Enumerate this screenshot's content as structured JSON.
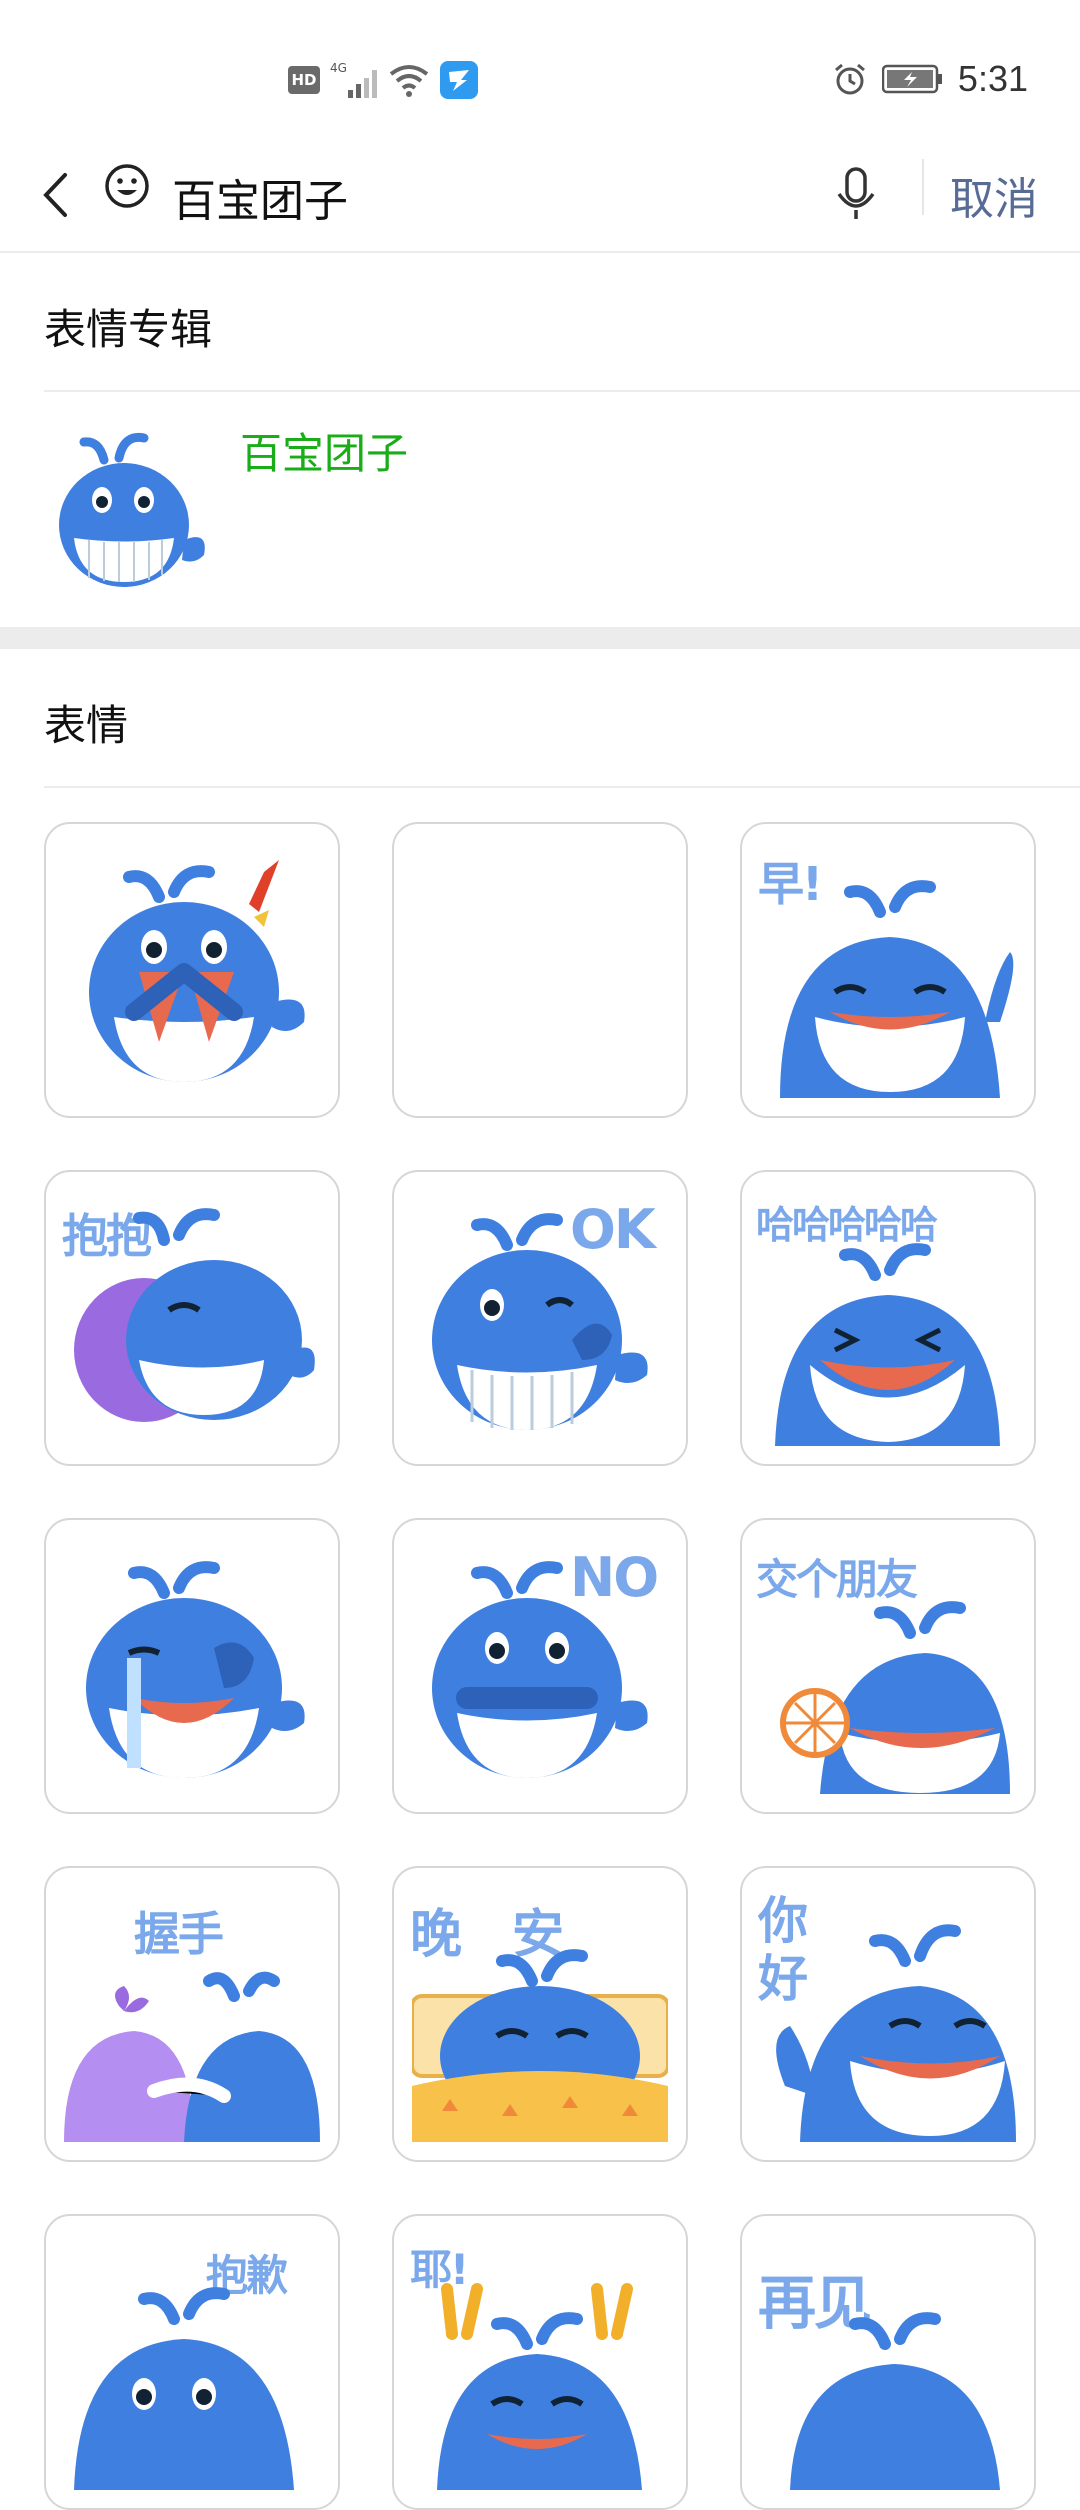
{
  "status_bar": {
    "network": "4G",
    "hd": "HD",
    "time": "5:31"
  },
  "search": {
    "query": "百宝团子",
    "cancel_label": "取消"
  },
  "album_section": {
    "title": "表情专辑",
    "album_name": "百宝团子"
  },
  "sticker_section": {
    "title": "表情",
    "stickers": [
      {
        "name": "covering-mouth",
        "caption": ""
      },
      {
        "name": "empty",
        "caption": ""
      },
      {
        "name": "good-morning",
        "caption": "早!"
      },
      {
        "name": "hug",
        "caption": "抱抱"
      },
      {
        "name": "ok",
        "caption": "OK"
      },
      {
        "name": "hahaha",
        "caption": "哈哈哈哈哈"
      },
      {
        "name": "crying",
        "caption": ""
      },
      {
        "name": "no",
        "caption": "NO"
      },
      {
        "name": "make-friends",
        "caption": "交个朋友"
      },
      {
        "name": "handshake",
        "caption": "握手"
      },
      {
        "name": "good-night",
        "caption": "晚安"
      },
      {
        "name": "hello",
        "caption": "你好"
      },
      {
        "name": "sorry",
        "caption": "抱歉"
      },
      {
        "name": "yeah",
        "caption": "耶!"
      },
      {
        "name": "goodbye",
        "caption": "再见"
      }
    ]
  },
  "colors": {
    "whale_blue": "#3f7fe0",
    "whale_light": "#6fa6f0",
    "accent_green": "#1aad19",
    "link_blue": "#576b95"
  }
}
